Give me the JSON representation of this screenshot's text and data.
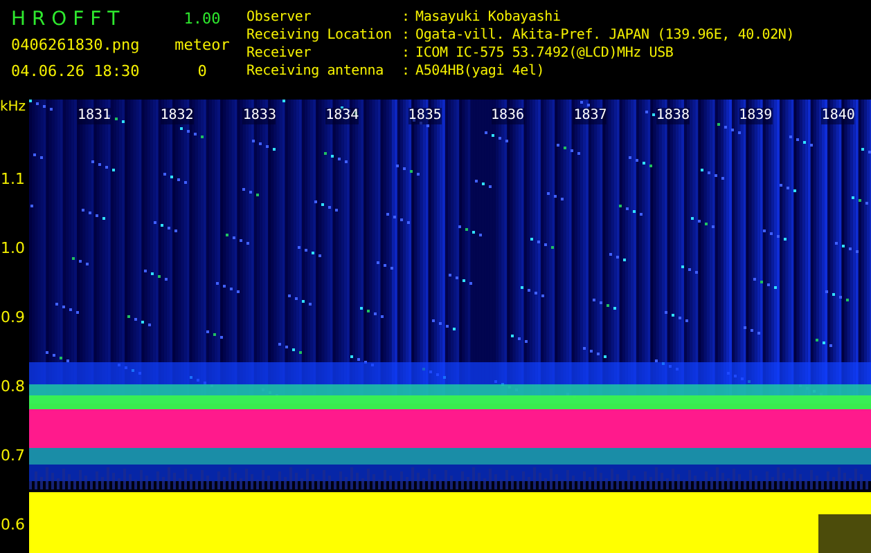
{
  "app": {
    "title": "H R O F F T",
    "version": "1.00"
  },
  "file": {
    "name": "0406261830.png",
    "datetime": "04.06.26 18:30"
  },
  "meteor": {
    "label": "meteor",
    "count": "0"
  },
  "station": [
    {
      "label": "Observer",
      "separator": ":",
      "value": "Masayuki Kobayashi"
    },
    {
      "label": "Receiving Location",
      "separator": ":",
      "value": "Ogata-vill. Akita-Pref. JAPAN (139.96E, 40.02N)"
    },
    {
      "label": "Receiver",
      "separator": ":",
      "value": "ICOM IC-575 53.7492(@LCD)MHz USB"
    },
    {
      "label": "Receiving antenna",
      "separator": ":",
      "value": "A504HB(yagi 4el)"
    }
  ],
  "spectrogram": {
    "y_unit": "kHz",
    "y_ticks": [
      "1.1",
      "1.0",
      "0.9",
      "0.8",
      "0.7",
      "0.6"
    ],
    "time_ticks": [
      "1831",
      "1832",
      "1833",
      "1834",
      "1835",
      "1836",
      "1837",
      "1838",
      "1839",
      "1840"
    ]
  }
}
